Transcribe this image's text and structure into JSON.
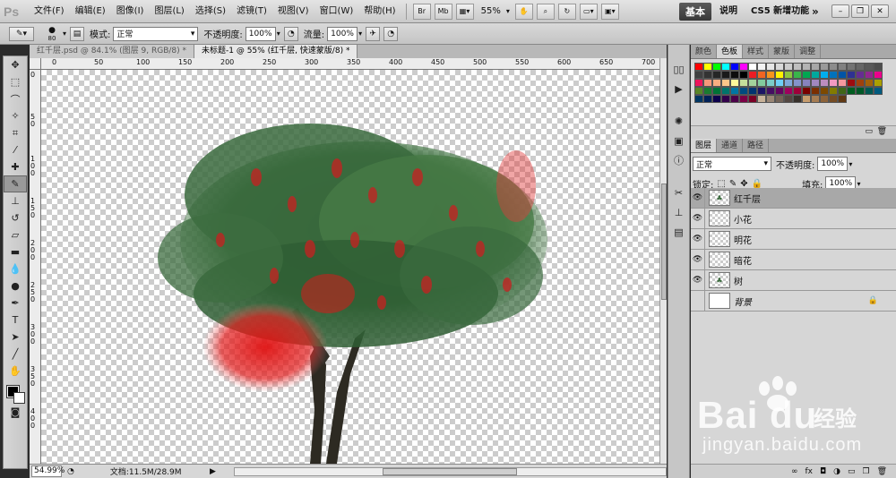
{
  "app": {
    "logo": "Ps"
  },
  "menu": [
    "文件(F)",
    "编辑(E)",
    "图像(I)",
    "图层(L)",
    "选择(S)",
    "滤镜(T)",
    "视图(V)",
    "窗口(W)",
    "帮助(H)"
  ],
  "menubar_buttons": {
    "br": "Br",
    "mb": "Mb",
    "zoom": "55%"
  },
  "workspace": {
    "active": "基本",
    "items": [
      "说明",
      "CS5 新增功能"
    ],
    "more": "»"
  },
  "options": {
    "brush_size": "80",
    "mode_label": "模式:",
    "mode_value": "正常",
    "opacity_label": "不透明度:",
    "opacity_value": "100%",
    "flow_label": "流量:",
    "flow_value": "100%"
  },
  "tabs": [
    "红千层.psd @ 84.1% (图层 9, RGB/8) *",
    "未标题-1 @ 55% (红千层, 快速蒙版/8) *"
  ],
  "ruler_h": [
    "0",
    "50",
    "100",
    "150",
    "200",
    "250",
    "300",
    "350",
    "400",
    "450",
    "500",
    "550",
    "600",
    "650",
    "700"
  ],
  "ruler_v": [
    "0",
    "50",
    "100",
    "150",
    "200",
    "250",
    "300",
    "350",
    "400"
  ],
  "status": {
    "zoom": "54.99%",
    "doc": "文档:11.5M/28.9M"
  },
  "swatch_panel": {
    "tabs": [
      "颜色",
      "色板",
      "样式",
      "蒙版",
      "调整"
    ],
    "active": 1
  },
  "swatch_colors": [
    "#ff0000",
    "#ffff00",
    "#00ff00",
    "#00ffff",
    "#0000ff",
    "#ff00ff",
    "#ffffff",
    "#f2f2f2",
    "#e6e6e6",
    "#d9d9d9",
    "#cccccc",
    "#bfbfbf",
    "#b3b3b3",
    "#a6a6a6",
    "#999999",
    "#8c8c8c",
    "#808080",
    "#737373",
    "#666666",
    "#595959",
    "#4d4d4d",
    "#404040",
    "#333333",
    "#262626",
    "#1a1a1a",
    "#0d0d0d",
    "#000000",
    "#ed1c24",
    "#f26522",
    "#f7941d",
    "#fff200",
    "#8dc63f",
    "#39b54a",
    "#00a651",
    "#00a99d",
    "#00aeef",
    "#0072bc",
    "#0054a6",
    "#2e3192",
    "#662d91",
    "#92278f",
    "#ec008c",
    "#ed145b",
    "#f7977a",
    "#f9ad81",
    "#fdc68a",
    "#fff79a",
    "#c4df9b",
    "#a3d39c",
    "#82ca9d",
    "#7bcdc8",
    "#6ecff6",
    "#7ea7d8",
    "#8493ca",
    "#8882be",
    "#a187be",
    "#bc8dbf",
    "#f49ac2",
    "#f6989d",
    "#9e0b0f",
    "#a0410d",
    "#a3620a",
    "#aba000",
    "#598527",
    "#1a7b30",
    "#007236",
    "#00746b",
    "#0076a3",
    "#004b80",
    "#003471",
    "#1b1464",
    "#440e62",
    "#630460",
    "#9e005d",
    "#9e0039",
    "#790000",
    "#7b2e00",
    "#7d4900",
    "#827b00",
    "#406618",
    "#005e20",
    "#005826",
    "#005952",
    "#005b7f",
    "#003663",
    "#002157",
    "#0d004c",
    "#32004b",
    "#4b0049",
    "#7b0046",
    "#7a0026",
    "#c7b299",
    "#998675",
    "#736357",
    "#534741",
    "#37302a",
    "#c69c6d",
    "#a67c52",
    "#8c6239",
    "#754c24",
    "#603913"
  ],
  "layers_panel": {
    "tabs": [
      "图层",
      "通道",
      "路径"
    ],
    "active": 0,
    "blend": "正常",
    "opacity_label": "不透明度:",
    "opacity": "100%",
    "lock_label": "锁定:",
    "fill_label": "填充:",
    "fill": "100%",
    "layers": [
      {
        "name": "红千层",
        "visible": true,
        "selected": true,
        "thumb": "tree"
      },
      {
        "name": "小花",
        "visible": true,
        "selected": false,
        "thumb": "empty"
      },
      {
        "name": "明花",
        "visible": true,
        "selected": false,
        "thumb": "empty"
      },
      {
        "name": "暗花",
        "visible": true,
        "selected": false,
        "thumb": "empty"
      },
      {
        "name": "树",
        "visible": true,
        "selected": false,
        "thumb": "tree"
      },
      {
        "name": "背景",
        "visible": false,
        "selected": false,
        "thumb": "white",
        "italic": true,
        "locked": true
      }
    ]
  },
  "watermark": {
    "brand": "Bai du",
    "cn": "经验",
    "url": "jingyan.baidu.com"
  }
}
